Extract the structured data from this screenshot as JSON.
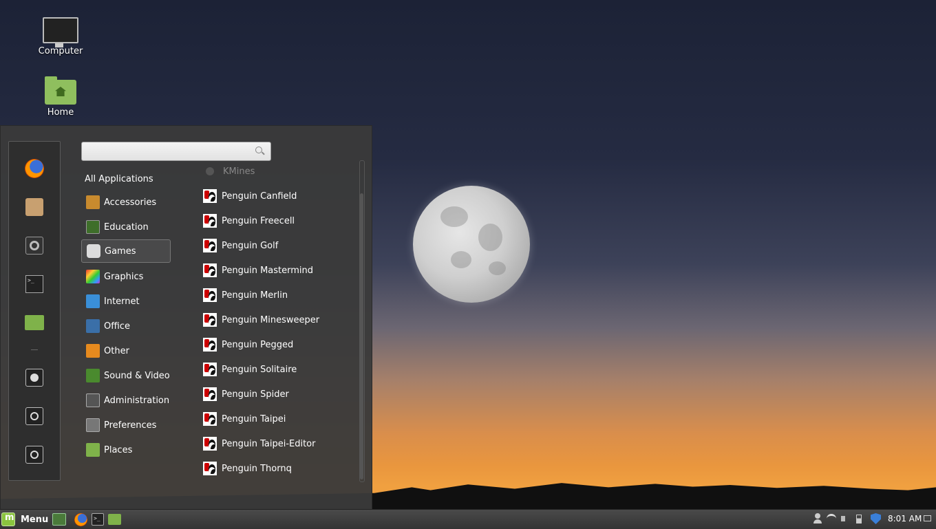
{
  "desktop": {
    "icons": [
      {
        "label": "Computer"
      },
      {
        "label": "Home"
      }
    ]
  },
  "menu": {
    "search": {
      "value": "",
      "placeholder": ""
    },
    "favorites": [
      "firefox",
      "software-manager",
      "system-settings",
      "terminal",
      "files",
      "lock-screen",
      "logout",
      "shutdown"
    ],
    "categories": [
      {
        "label": "All Applications",
        "icon": "none"
      },
      {
        "label": "Accessories",
        "icon": "accessories-icon",
        "color": "#c88a2e"
      },
      {
        "label": "Education",
        "icon": "education-icon",
        "color": "#3e6e2a"
      },
      {
        "label": "Games",
        "icon": "games-icon",
        "color": "#dcdcdc",
        "selected": true
      },
      {
        "label": "Graphics",
        "icon": "graphics-icon",
        "color": "#d63fa0"
      },
      {
        "label": "Internet",
        "icon": "internet-icon",
        "color": "#3a8fd8"
      },
      {
        "label": "Office",
        "icon": "office-icon",
        "color": "#3a6fa8"
      },
      {
        "label": "Other",
        "icon": "other-icon",
        "color": "#e68a1e"
      },
      {
        "label": "Sound & Video",
        "icon": "sound-video-icon",
        "color": "#4a8a2e"
      },
      {
        "label": "Administration",
        "icon": "administration-icon",
        "color": "#555555"
      },
      {
        "label": "Preferences",
        "icon": "preferences-icon",
        "color": "#777777"
      },
      {
        "label": "Places",
        "icon": "places-icon",
        "color": "#7fb24a"
      }
    ],
    "apps": [
      {
        "label": "KMines",
        "dim": true
      },
      {
        "label": "Penguin Canfield"
      },
      {
        "label": "Penguin Freecell"
      },
      {
        "label": "Penguin Golf"
      },
      {
        "label": "Penguin Mastermind"
      },
      {
        "label": "Penguin Merlin"
      },
      {
        "label": "Penguin Minesweeper"
      },
      {
        "label": "Penguin Pegged"
      },
      {
        "label": "Penguin Solitaire"
      },
      {
        "label": "Penguin Spider"
      },
      {
        "label": "Penguin Taipei"
      },
      {
        "label": "Penguin Taipei-Editor"
      },
      {
        "label": "Penguin Thornq"
      }
    ]
  },
  "taskbar": {
    "menu_label": "Menu",
    "clock": "8:01 AM"
  }
}
